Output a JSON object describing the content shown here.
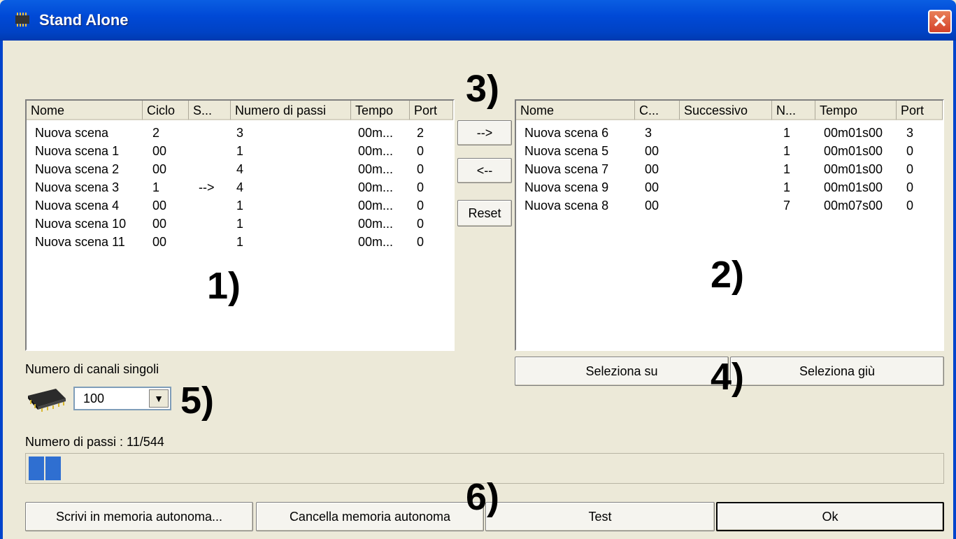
{
  "window": {
    "title": "Stand Alone",
    "close_label": "✕"
  },
  "left_list": {
    "columns": [
      "Nome",
      "Ciclo",
      "S...",
      "Numero di passi",
      "Tempo",
      "Port"
    ],
    "rows": [
      [
        "Nuova scena",
        "2",
        "",
        "3",
        "00m...",
        "2"
      ],
      [
        "Nuova scena 1",
        "00",
        "",
        "1",
        "00m...",
        "0"
      ],
      [
        "Nuova scena 2",
        "00",
        "",
        "4",
        "00m...",
        "0"
      ],
      [
        "Nuova scena 3",
        "1",
        "-->",
        "4",
        "00m...",
        "0"
      ],
      [
        "Nuova scena 4",
        "00",
        "",
        "1",
        "00m...",
        "0"
      ],
      [
        "Nuova scena 10",
        "00",
        "",
        "1",
        "00m...",
        "0"
      ],
      [
        "Nuova scena 11",
        "00",
        "",
        "1",
        "00m...",
        "0"
      ]
    ]
  },
  "right_list": {
    "columns": [
      "Nome",
      "C...",
      "Successivo",
      "N...",
      "Tempo",
      "Port"
    ],
    "rows": [
      [
        "Nuova scena 6",
        "3",
        "",
        "1",
        "00m01s00",
        "3"
      ],
      [
        "Nuova scena 5",
        "00",
        "",
        "1",
        "00m01s00",
        "0"
      ],
      [
        "Nuova scena 7",
        "00",
        "",
        "1",
        "00m01s00",
        "0"
      ],
      [
        "Nuova scena 9",
        "00",
        "",
        "1",
        "00m01s00",
        "0"
      ],
      [
        "Nuova scena 8",
        "00",
        "",
        "7",
        "00m07s00",
        "0"
      ]
    ]
  },
  "transfer": {
    "add_label": "-->",
    "remove_label": "<--",
    "reset_label": "Reset"
  },
  "select": {
    "up_label": "Seleziona su",
    "down_label": "Seleziona giù"
  },
  "channels": {
    "label": "Numero di canali singoli",
    "value": "100",
    "icon": "chip-icon"
  },
  "steps": {
    "label": "Numero di passi : 11/544",
    "progress_fraction": 0.02
  },
  "footer": {
    "write_label": "Scrivi in memoria autonoma...",
    "erase_label": "Cancella memoria autonoma",
    "test_label": "Test",
    "ok_label": "Ok"
  },
  "annotations": {
    "a1": "1)",
    "a2": "2)",
    "a3": "3)",
    "a4": "4)",
    "a5": "5)",
    "a6": "6)"
  }
}
